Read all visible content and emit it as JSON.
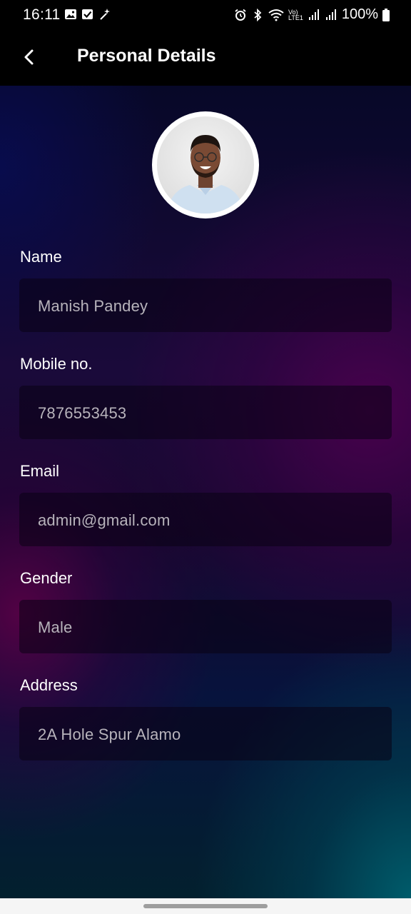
{
  "status_bar": {
    "time": "16:11",
    "battery": "100%",
    "left_icons": [
      "image-icon",
      "check-box-icon",
      "magic-wand-icon"
    ],
    "right_icons": [
      "alarm-icon",
      "bluetooth-icon",
      "wifi-icon",
      "volte-icon",
      "signal-icon",
      "signal-icon",
      "battery-icon"
    ],
    "volte_label_top": "Vo)",
    "volte_label_bottom": "LTE1"
  },
  "app_bar": {
    "title": "Personal Details",
    "back_icon": "back-arrow-icon"
  },
  "profile": {
    "avatar": "user-avatar"
  },
  "fields": [
    {
      "label": "Name",
      "value": "Manish Pandey"
    },
    {
      "label": "Mobile no.",
      "value": "7876553453"
    },
    {
      "label": "Email",
      "value": "admin@gmail.com"
    },
    {
      "label": "Gender",
      "value": "Male"
    },
    {
      "label": "Address",
      "value": "2A Hole Spur Alamo"
    }
  ],
  "colors": {
    "text": "#ffffff",
    "field_value": "#b7b3bb",
    "field_bg": "#0a0214",
    "bar_bg": "#000000"
  }
}
